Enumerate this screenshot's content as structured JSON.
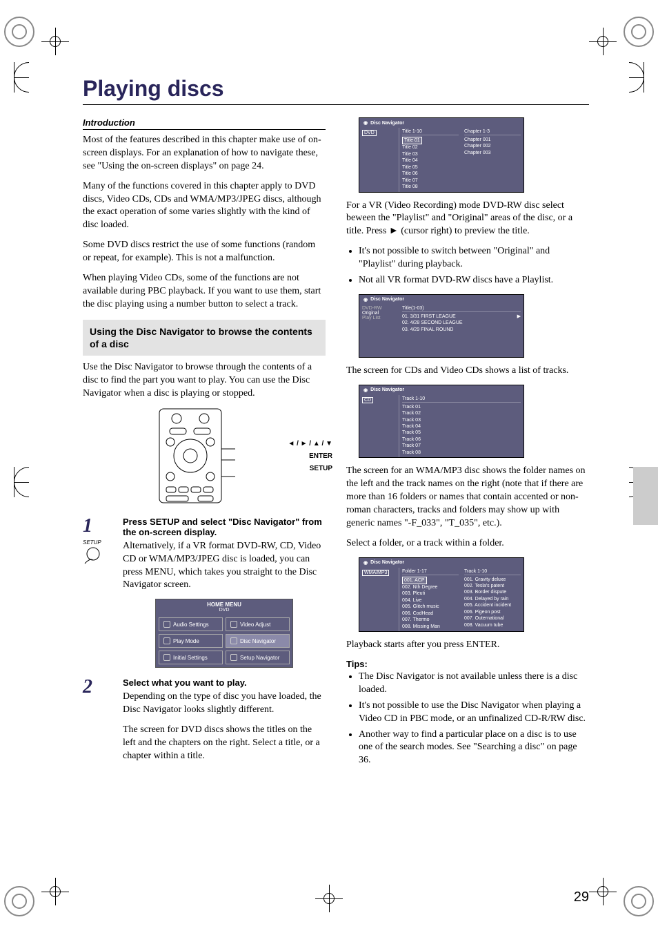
{
  "page_number": "29",
  "title": "Playing discs",
  "intro_heading": "Introduction",
  "intro_p1": "Most of the features described in this chapter make use of on-screen displays. For an explanation of how to navigate these, see \"Using the on-screen displays\" on page 24.",
  "intro_p2": "Many of the functions covered in this chapter apply to DVD discs, Video CDs, CDs and WMA/MP3/JPEG discs, although the exact operation of some varies slightly with the kind of disc loaded.",
  "intro_p3": "Some DVD discs restrict the use of some functions (random or repeat, for example). This is not a malfunction.",
  "intro_p4": "When playing Video CDs, some of the functions are not available during PBC playback. If you want to use them, start the disc playing using a number button to select a track.",
  "section_heading": "Using the Disc Navigator to browse the contents of a disc",
  "section_p": "Use the Disc Navigator to browse through the contents of a disc to find the part you want to play. You can use the Disc Navigator when a disc is playing or stopped.",
  "remote_labels": {
    "arrows": "◄ / ► / ▲ / ▼",
    "enter": "ENTER",
    "setup": "SETUP"
  },
  "step1": {
    "num": "1",
    "icon_label": "SETUP",
    "head": "Press SETUP and select \"Disc Navigator\" from the on-screen display.",
    "body": "Alternatively, if a VR format DVD-RW, CD, Video CD or WMA/MP3/JPEG disc is loaded, you can press MENU, which takes you straight to the Disc Navigator screen."
  },
  "home_menu": {
    "title": "HOME MENU",
    "sub": "DVD",
    "cells": [
      "Audio Settings",
      "Video Adjust",
      "Play Mode",
      "Disc Navigator",
      "Initial Settings",
      "Setup Navigator"
    ]
  },
  "step2": {
    "num": "2",
    "head": "Select what you want to play.",
    "body1": "Depending on the type of disc you have loaded, the Disc Navigator looks slightly different.",
    "body2": "The screen for DVD discs shows the titles on the left and the chapters on the right. Select a title, or a chapter within a title."
  },
  "nav_dvd": {
    "title": "Disc Navigator",
    "side": "DVD",
    "left_hdr": "Title 1-10",
    "right_hdr": "Chapter 1-3",
    "titles": [
      "Title 01",
      "Title 02",
      "Title 03",
      "Title 04",
      "Title 05",
      "Title 06",
      "Title 07",
      "Title 08"
    ],
    "chapters": [
      "Chapter 001",
      "Chapter 002",
      "Chapter 003"
    ]
  },
  "vr_p": "For a VR (Video Recording) mode DVD-RW disc select beween the \"Playlist\" and \"Original\" areas of the disc, or a title. Press ► (cursor right) to preview the title.",
  "vr_b1": "It's not possible to switch between \"Original\" and \"Playlist\" during playback.",
  "vr_b2": "Not all VR format DVD-RW discs have a Playlist.",
  "nav_vr": {
    "title": "Disc Navigator",
    "side_a": "DVD-RW",
    "side_b": "Original",
    "side_c": "Play List",
    "hdr": "Title(1-03)",
    "rows": [
      "01. 3/31 FIRST LEAGUE",
      "02. 4/28 SECOND LEAGUE",
      "03. 4/29 FINAL ROUND"
    ]
  },
  "cd_p": "The screen for CDs and Video CDs shows a list of tracks.",
  "nav_cd": {
    "title": "Disc Navigator",
    "side": "CD",
    "hdr": "Track 1-10",
    "rows": [
      "Track 01",
      "Track 02",
      "Track 03",
      "Track 04",
      "Track 05",
      "Track 06",
      "Track 07",
      "Track 08"
    ]
  },
  "mp3_p": "The screen for an WMA/MP3 disc shows the folder names on the left and the track names on the right (note that if there are more than 16 folders or names that contain accented or non-roman characters, tracks and folders may show up with generic names \"-F_033\", \"T_035\", etc.).",
  "mp3_p2": "Select a folder, or a track within a folder.",
  "nav_mp3": {
    "title": "Disc Navigator",
    "side": "WMA/MP3",
    "left_hdr": "Folder 1-17",
    "right_hdr": "Track 1-10",
    "folders": [
      "001. ACP",
      "002. Nth Degree",
      "003. Pleuti",
      "004. Live",
      "005. Glitch music",
      "006. CodHead",
      "007. Thermo",
      "008. Missing Man"
    ],
    "tracks": [
      "001. Gravity deluxe",
      "002. Tesla's patent",
      "003. Border dispute",
      "004. Delayed by rain",
      "005. Accident incident",
      "006. Pigeon post",
      "007. Outernational",
      "008. Vacuum tube"
    ]
  },
  "play_p": "Playback starts after you press ENTER.",
  "tips_head": "Tips:",
  "tip1": "The Disc Navigator is not available unless there is a disc loaded.",
  "tip2": "It's not possible to use the Disc Navigator when playing a Video CD in PBC mode, or an unfinalized CD-R/RW disc.",
  "tip3": "Another way to find a particular place on a disc is to use one of the search modes. See \"Searching a disc\" on page 36."
}
